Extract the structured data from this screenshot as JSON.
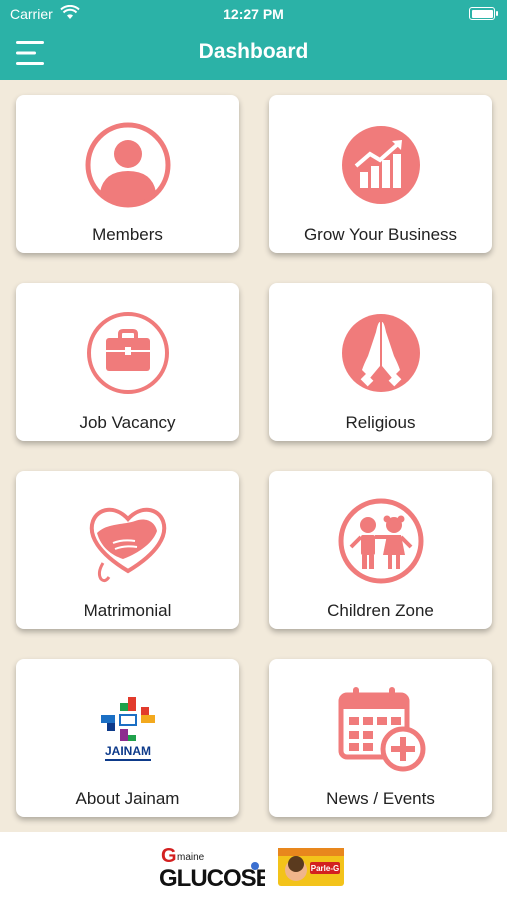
{
  "status_bar": {
    "carrier": "Carrier",
    "time": "12:27 PM"
  },
  "header": {
    "title": "Dashboard"
  },
  "tiles": [
    {
      "label": "Members",
      "icon": "person-icon"
    },
    {
      "label": "Grow Your Business",
      "icon": "growth-chart-icon"
    },
    {
      "label": "Job Vacancy",
      "icon": "briefcase-icon"
    },
    {
      "label": "Religious",
      "icon": "praying-hands-icon"
    },
    {
      "label": "Matrimonial",
      "icon": "heart-handshake-icon"
    },
    {
      "label": "Children Zone",
      "icon": "children-icon"
    },
    {
      "label": "About Jainam",
      "icon": "jainam-logo"
    },
    {
      "label": "News / Events",
      "icon": "calendar-add-icon"
    }
  ],
  "jainam_logo_text": "JAINAM",
  "footer_ad": {
    "brand_left": "G maine GLUCOSE",
    "brand_right": "Parle-G"
  },
  "colors": {
    "header": "#2bb2a7",
    "accent": "#f07b7b",
    "background": "#f2eadb"
  }
}
